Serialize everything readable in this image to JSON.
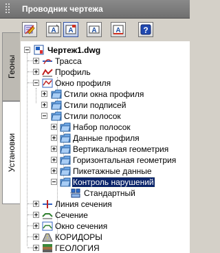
{
  "panel": {
    "title": "Проводник чертежа"
  },
  "side_tabs": [
    {
      "label": "Геоны",
      "active": false
    },
    {
      "label": "Установки",
      "active": true
    }
  ],
  "toolbar": {
    "buttons": [
      {
        "name": "edit-settings-icon"
      },
      {
        "name": "style-a-icon"
      },
      {
        "name": "style-a-active-icon"
      },
      {
        "name": "label-a-icon"
      },
      {
        "name": "label-a-red-icon"
      },
      {
        "name": "help-icon"
      }
    ],
    "help_glyph": "?"
  },
  "tree": {
    "root": "Чертеж1.dwg",
    "items": {
      "trassa": "Трасса",
      "profil": "Профиль",
      "okno_profilya": "Окно профиля",
      "stili_okna": "Стили окна профиля",
      "stili_podpisei": "Стили подписей",
      "stili_polosok": "Стили полосок",
      "nabor_polosok": "Набор полосок",
      "dannye_profilya": "Данные профиля",
      "vert_geom": "Вертикальная геометрия",
      "goriz_geom": "Горизонтальная геометрия",
      "piketazh": "Пикетажные данные",
      "kontrol": "Контроль нарушений",
      "standartny": "Стандартный",
      "liniya_secheniya": "Линия сечения",
      "sechenie": "Сечение",
      "okno_secheniya": "Окно сечения",
      "koridory": "КОРИДОРЫ",
      "geologiya": "ГЕОЛОГИЯ"
    },
    "selected": "Контроль нарушений"
  },
  "colors": {
    "selection": "#0a246a",
    "folder": "#6fa8e6",
    "title_bar": "#7a7a7a"
  }
}
